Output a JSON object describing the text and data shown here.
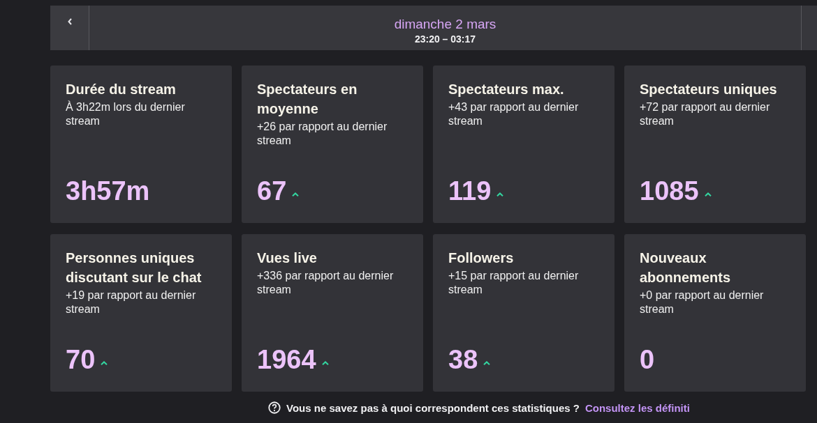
{
  "header": {
    "title": "dimanche 2 mars",
    "time_range": "23:20 – 03:17"
  },
  "stats": [
    {
      "title": "Durée du stream",
      "comparison": "À 3h22m lors du dernier stream",
      "value": "3h57m",
      "trend_up": false
    },
    {
      "title": "Spectateurs en moyenne",
      "comparison": "+26 par rapport au dernier stream",
      "value": "67",
      "trend_up": true
    },
    {
      "title": "Spectateurs max.",
      "comparison": "+43 par rapport au dernier stream",
      "value": "119",
      "trend_up": true
    },
    {
      "title": "Spectateurs uniques",
      "comparison": "+72 par rapport au dernier stream",
      "value": "1085",
      "trend_up": true
    },
    {
      "title": "Personnes uniques discutant sur le chat",
      "comparison": "+19 par rapport au dernier stream",
      "value": "70",
      "trend_up": true
    },
    {
      "title": "Vues live",
      "comparison": "+336 par rapport au dernier stream",
      "value": "1964",
      "trend_up": true
    },
    {
      "title": "Followers",
      "comparison": "+15 par rapport au dernier stream",
      "value": "38",
      "trend_up": true
    },
    {
      "title": "Nouveaux abonnements",
      "comparison": "+0 par rapport au dernier stream",
      "value": "0",
      "trend_up": false
    }
  ],
  "help": {
    "text": "Vous ne savez pas à quoi correspondent ces statistiques ?",
    "link": "Consultez les définiti"
  }
}
